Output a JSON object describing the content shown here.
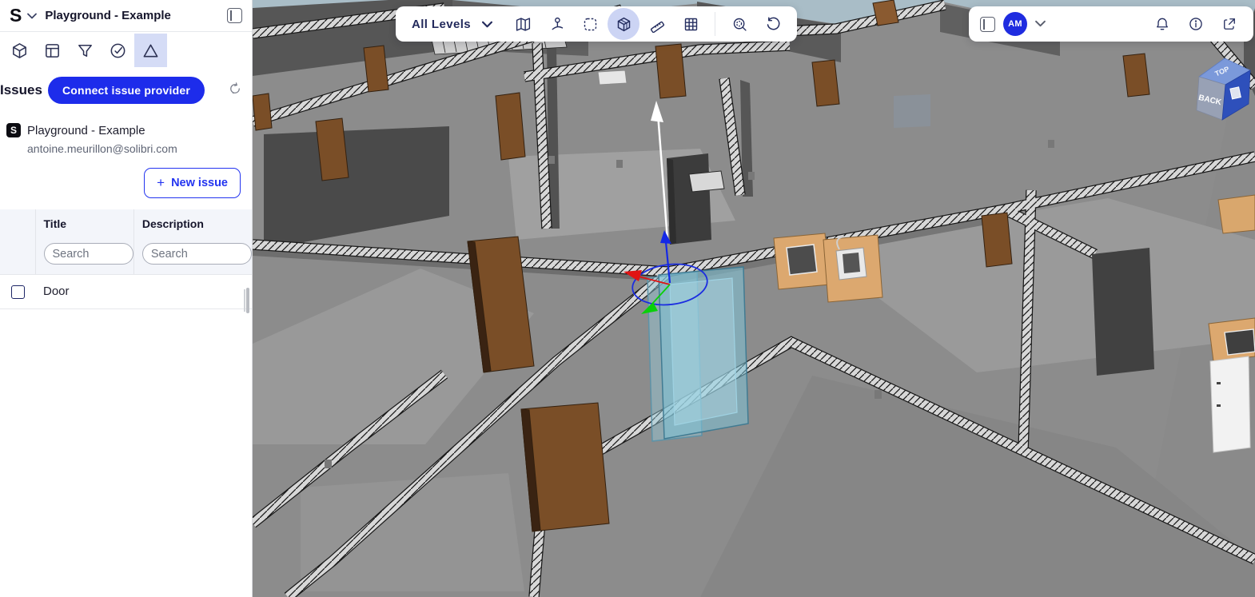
{
  "app": {
    "title": "Playground - Example"
  },
  "sidebar": {
    "logo": "S",
    "title": "Playground - Example",
    "tools": [
      {
        "name": "model-cube"
      },
      {
        "name": "layout-panels"
      },
      {
        "name": "filter-funnel"
      },
      {
        "name": "checks"
      },
      {
        "name": "issues-triangle",
        "active": true
      }
    ],
    "issues": {
      "heading": "Issues",
      "connect_button": "Connect issue provider",
      "refresh_icon": "sync-icon"
    },
    "provider": {
      "badge": "S",
      "name": "Playground - Example",
      "email": "antoine.meurillon@solibri.com"
    },
    "new_issue": {
      "plus": "+",
      "label": "New issue"
    },
    "table": {
      "columns": {
        "title": "Title",
        "description": "Description"
      },
      "search_placeholder": "Search",
      "rows": [
        {
          "checked": false,
          "title": "Door",
          "description": ""
        }
      ]
    }
  },
  "viewer": {
    "toolbar": {
      "level_selector": "All Levels",
      "icons": [
        "map",
        "walk-mode",
        "fit-selection",
        "cube-3d",
        "ruler",
        "grid",
        "zoom-selection",
        "reset-view"
      ],
      "active_icon": "cube-3d"
    },
    "topbar": {
      "avatar_initials": "AM",
      "icons": [
        "panel-right",
        "notifications-bell",
        "info",
        "share"
      ]
    },
    "nav_cube": {
      "top_label": "TOP",
      "front_label": "BACK"
    },
    "selection": {
      "object": "Door",
      "gizmo_axes": [
        "x-red",
        "y-green",
        "z-blue",
        "up-white"
      ]
    },
    "colors": {
      "accent_blue": "#2334f0",
      "active_tool_bg": "#d5dcf6",
      "sky": "#a9bdc7",
      "wall_gray": "#8c8c8c",
      "door_brown": "#7a4e27",
      "selected_cyan": "#7dc3d7",
      "gizmo_red": "#e01414",
      "gizmo_green": "#0ad00a",
      "gizmo_blue": "#1b2de0"
    }
  }
}
